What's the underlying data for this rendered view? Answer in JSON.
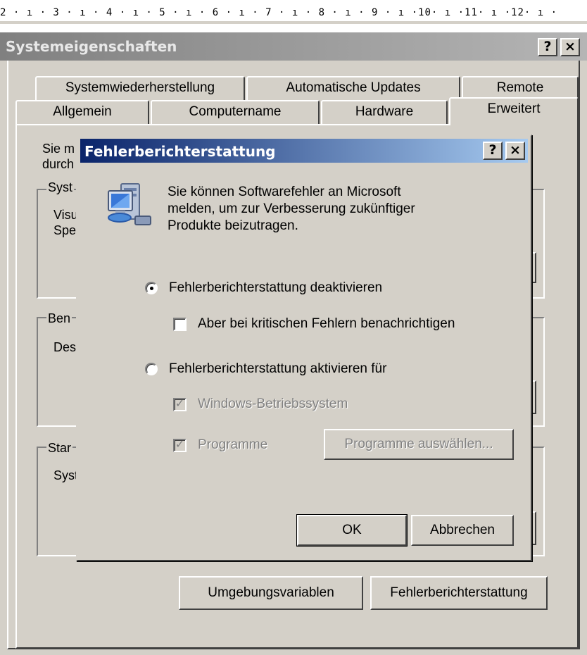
{
  "ruler": {
    "text": "2 · ı · 3 · ı · 4 · ı · 5 · ı · 6 · ı · 7 · ı · 8 · ı · 9 · ı ·10· ı ·11· ı ·12· ı ·"
  },
  "outer_window": {
    "title": "Systemeigenschaften",
    "help_label": "?",
    "close_label": "×",
    "tabs_back": [
      "Systemwiederherstellung",
      "Automatische Updates",
      "Remote"
    ],
    "tabs_front": [
      "Allgemein",
      "Computername",
      "Hardware",
      "Erweitert"
    ],
    "active_tab": "Erweitert",
    "panel": {
      "intro_line1": "Sie m",
      "intro_line2": "durch",
      "group1_label": "Syst",
      "group1_line1": "Visu",
      "group1_line2": "Spe",
      "group2_label": "Ben",
      "group2_line1": "Des",
      "group3_label": "Star",
      "group3_line1": "Syst",
      "env_button": "Umgebungsvariablen",
      "error_button": "Fehlerberichterstattung"
    }
  },
  "dialog": {
    "title": "Fehlerberichterstattung",
    "help_label": "?",
    "close_label": "×",
    "icon": "computer-network-icon",
    "info_lines": [
      "Sie können Softwarefehler an Microsoft",
      "melden, um zur Verbesserung zukünftiger",
      "Produkte beizutragen."
    ],
    "radio_disable": {
      "label": "Fehlerberichterstattung deaktivieren",
      "checked": true
    },
    "check_critical": {
      "label": "Aber bei kritischen Fehlern benachrichtigen",
      "checked": false
    },
    "radio_enable": {
      "label": "Fehlerberichterstattung aktivieren für",
      "checked": false
    },
    "check_windows": {
      "label": "Windows-Betriebssystem",
      "checked": true,
      "enabled": false
    },
    "check_programs": {
      "label": "Programme",
      "checked": true,
      "enabled": false
    },
    "select_programs_button": "Programme auswählen...",
    "ok_button": "OK",
    "cancel_button": "Abbrechen"
  }
}
